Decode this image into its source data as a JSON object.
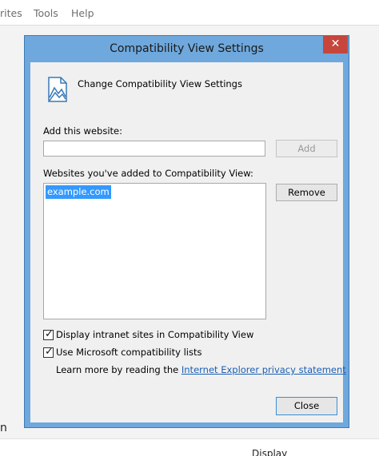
{
  "browser": {
    "menu": [
      "rites",
      "Tools",
      "Help"
    ],
    "bg_left_fragment": "n",
    "bg_display": "Display"
  },
  "dialog": {
    "title": "Compatibility View Settings",
    "close_glyph": "✕",
    "header_icon": "compatibility-view-icon",
    "header_text": "Change Compatibility View Settings",
    "add_label": "Add this website:",
    "add_input_value": "",
    "add_button": "Add",
    "list_label": "Websites you've added to Compatibility View:",
    "sites": [
      "example.com"
    ],
    "remove_button": "Remove",
    "options": [
      {
        "label": "Display intranet sites in Compatibility View",
        "checked": true
      },
      {
        "label": "Use Microsoft compatibility lists",
        "checked": true
      }
    ],
    "learn_more_prefix": "Learn more by reading the",
    "learn_more_link": "Internet Explorer privacy statement",
    "close_button": "Close"
  },
  "colors": {
    "titlebar": "#6fa8dc",
    "close_red": "#c7463c",
    "selection": "#3399ff",
    "link": "#1a5fb4"
  }
}
